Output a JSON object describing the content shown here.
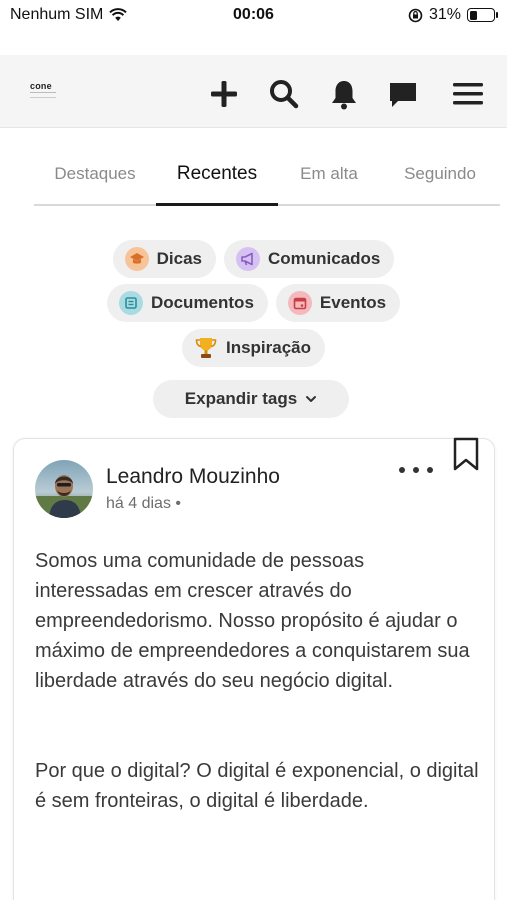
{
  "status_bar": {
    "carrier": "Nenhum SIM",
    "time": "00:06",
    "battery_percent": "31%",
    "battery_level": 0.31
  },
  "app_bar": {
    "logo_text": "cone",
    "icons": [
      "plus-icon",
      "search-icon",
      "bell-icon",
      "chat-icon",
      "menu-icon"
    ]
  },
  "tabs": [
    {
      "label": "Destaques",
      "active": false
    },
    {
      "label": "Recentes",
      "active": true
    },
    {
      "label": "Em alta",
      "active": false
    },
    {
      "label": "Seguindo",
      "active": false
    }
  ],
  "tags": [
    {
      "label": "Dicas",
      "icon": "graduation-cap-icon",
      "color": "#f4a66a"
    },
    {
      "label": "Comunicados",
      "icon": "megaphone-icon",
      "color": "#b48ee0"
    },
    {
      "label": "Documentos",
      "icon": "document-icon",
      "color": "#5fb7c4"
    },
    {
      "label": "Eventos",
      "icon": "calendar-icon",
      "color": "#e2686e"
    },
    {
      "label": "Inspiração",
      "icon": "trophy-icon",
      "color": "#e8a317"
    }
  ],
  "expand_tags_label": "Expandir tags",
  "post": {
    "author": "Leandro Mouzinho",
    "time": "há 4 dias",
    "separator": "•",
    "paragraphs": [
      "Somos uma comunidade de pessoas interessadas em crescer através do empreendedorismo. Nosso propósito é ajudar o máximo de empreendedores a conquistarem sua liberdade através do seu negócio digital.",
      "Por que o digital? O digital é exponencial, o digital é sem fronteiras, o digital é liberdade."
    ]
  }
}
